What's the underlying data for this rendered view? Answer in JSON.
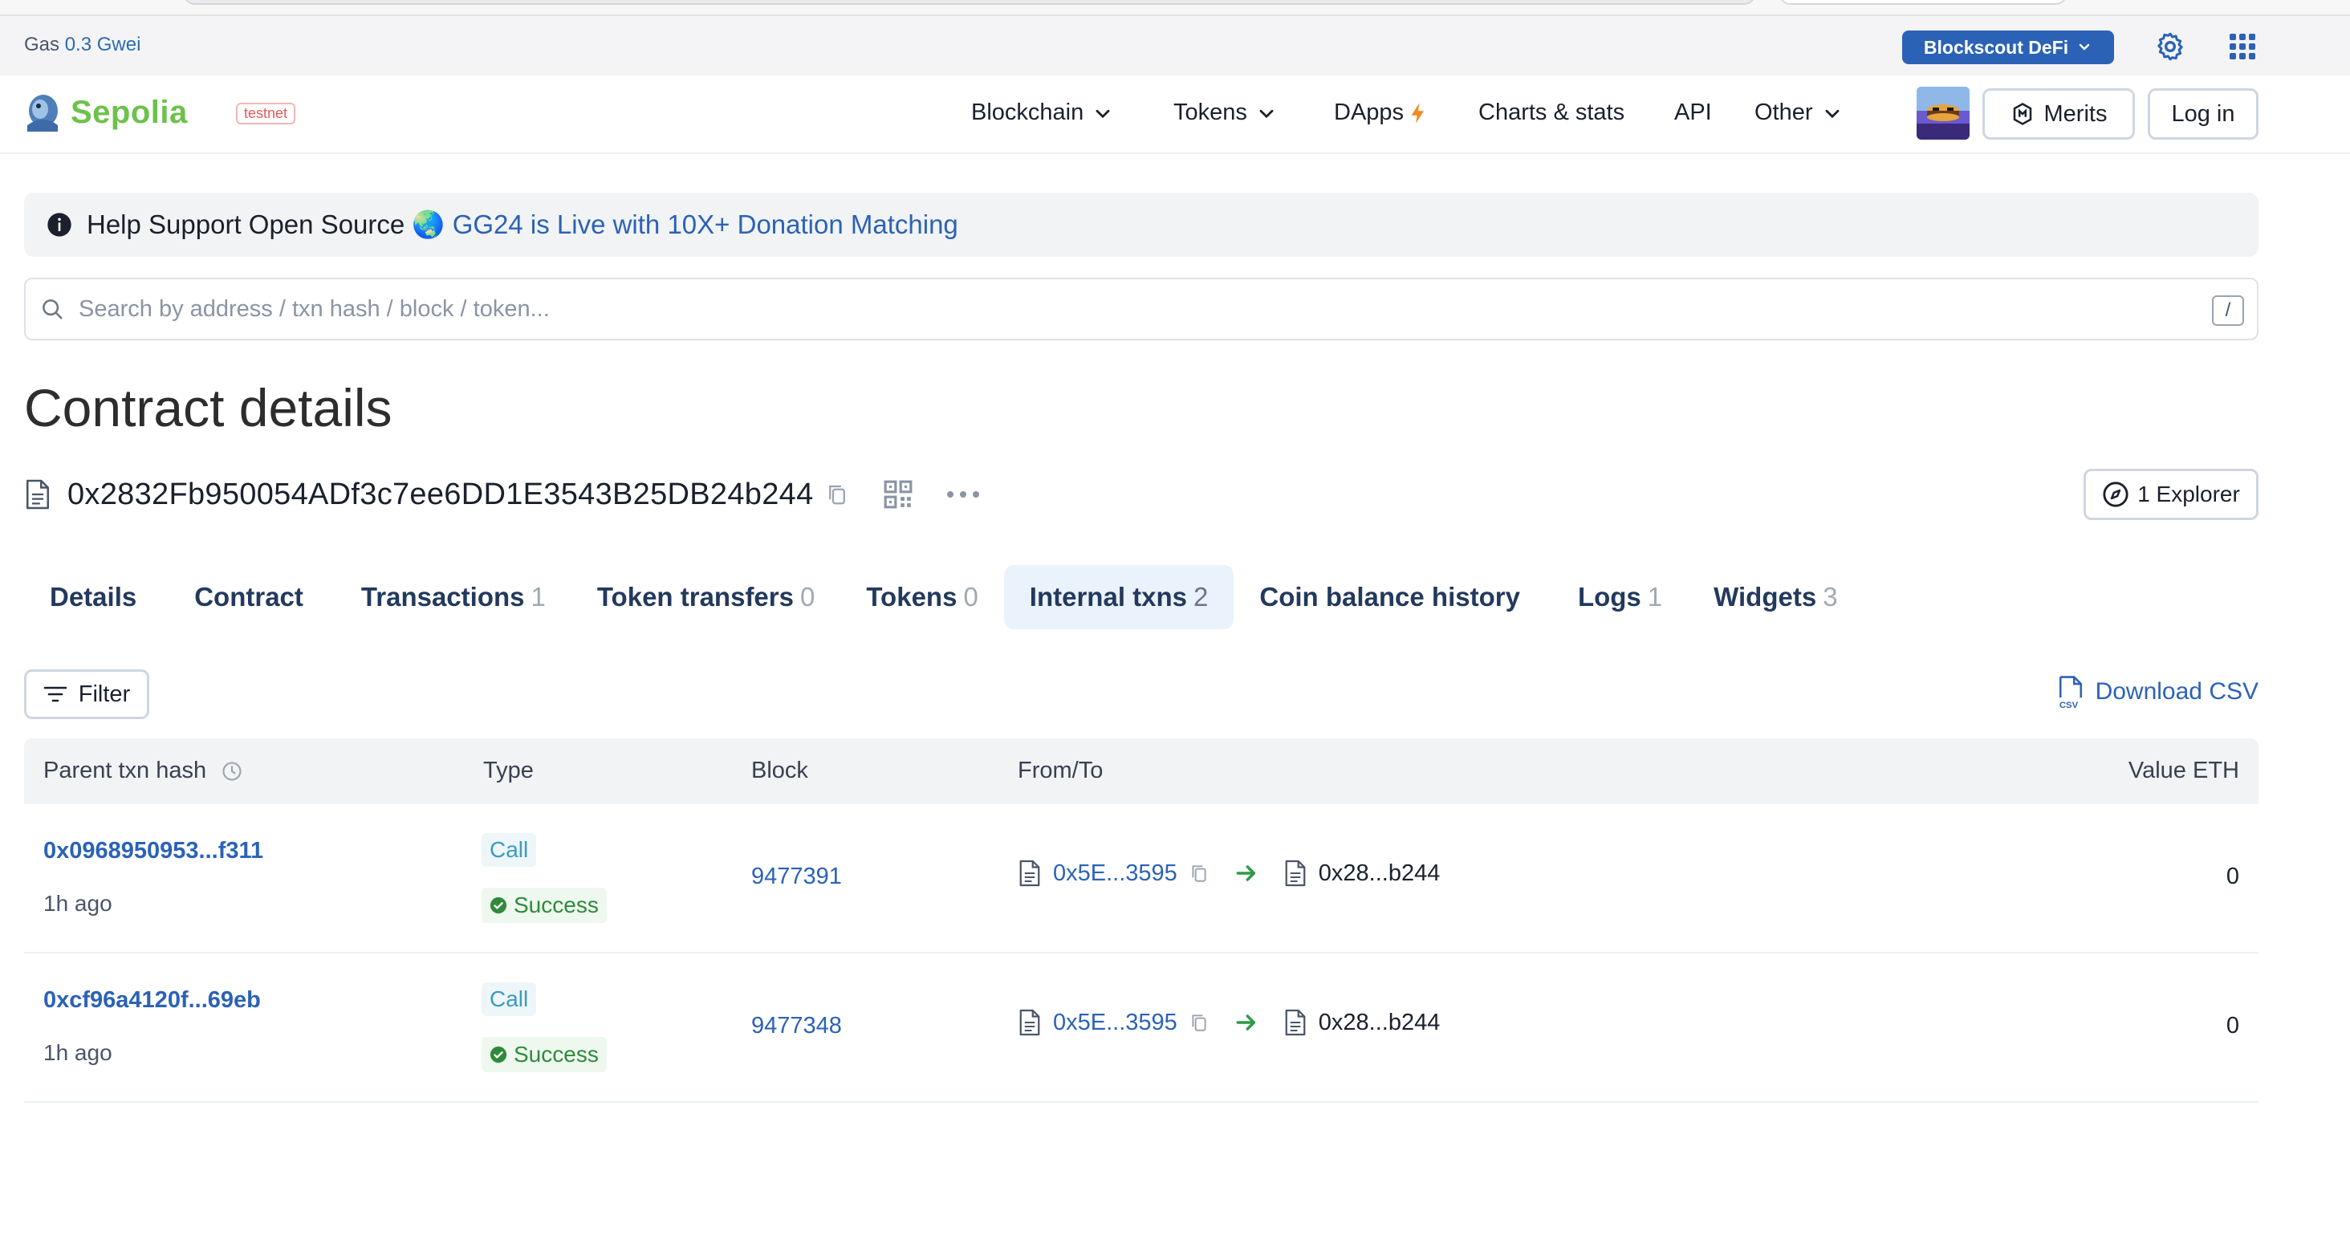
{
  "gas": {
    "label": "Gas",
    "value": "0.3 Gwei"
  },
  "defi_button": "Blockscout DeFi",
  "brand": {
    "name": "Sepolia",
    "badge": "testnet"
  },
  "nav": [
    {
      "label": "Blockchain",
      "dropdown": true
    },
    {
      "label": "Tokens",
      "dropdown": true
    },
    {
      "label": "DApps",
      "dropdown": false
    },
    {
      "label": "Charts & stats",
      "dropdown": false
    },
    {
      "label": "API",
      "dropdown": false
    },
    {
      "label": "Other",
      "dropdown": true
    }
  ],
  "merits_label": "Merits",
  "login_label": "Log in",
  "alert": {
    "prefix": "Help Support Open Source",
    "emoji": "🌏",
    "link": "GG24 is Live with 10X+ Donation Matching"
  },
  "search": {
    "placeholder": "Search by address / txn hash / block / token...",
    "shortcut": "/"
  },
  "page_title": "Contract details",
  "address": "0x2832Fb950054ADf3c7ee6DD1E3543B25DB24b244",
  "explorer_label": "1 Explorer",
  "tabs": [
    {
      "label": "Details",
      "count": ""
    },
    {
      "label": "Contract",
      "count": ""
    },
    {
      "label": "Transactions",
      "count": "1"
    },
    {
      "label": "Token transfers",
      "count": "0"
    },
    {
      "label": "Tokens",
      "count": "0"
    },
    {
      "label": "Internal txns",
      "count": "2",
      "active": true
    },
    {
      "label": "Coin balance history",
      "count": ""
    },
    {
      "label": "Logs",
      "count": "1"
    },
    {
      "label": "Widgets",
      "count": "3"
    }
  ],
  "filter_label": "Filter",
  "download_label": "Download CSV",
  "table": {
    "headers": {
      "hash": "Parent txn hash",
      "type": "Type",
      "block": "Block",
      "from_to": "From/To",
      "value": "Value ETH"
    },
    "rows": [
      {
        "hash": "0x0968950953...f311",
        "age": "1h ago",
        "type": "Call",
        "status": "Success",
        "block": "9477391",
        "from": "0x5E...3595",
        "to": "0x28...b244",
        "value": "0"
      },
      {
        "hash": "0xcf96a4120f...69eb",
        "age": "1h ago",
        "type": "Call",
        "status": "Success",
        "block": "9477348",
        "from": "0x5E...3595",
        "to": "0x28...b244",
        "value": "0"
      }
    ]
  },
  "colors": {
    "accent": "#2b62b6",
    "brand_green": "#6cc24a",
    "success": "#2f8a3a",
    "call": "#3b9bc2"
  }
}
